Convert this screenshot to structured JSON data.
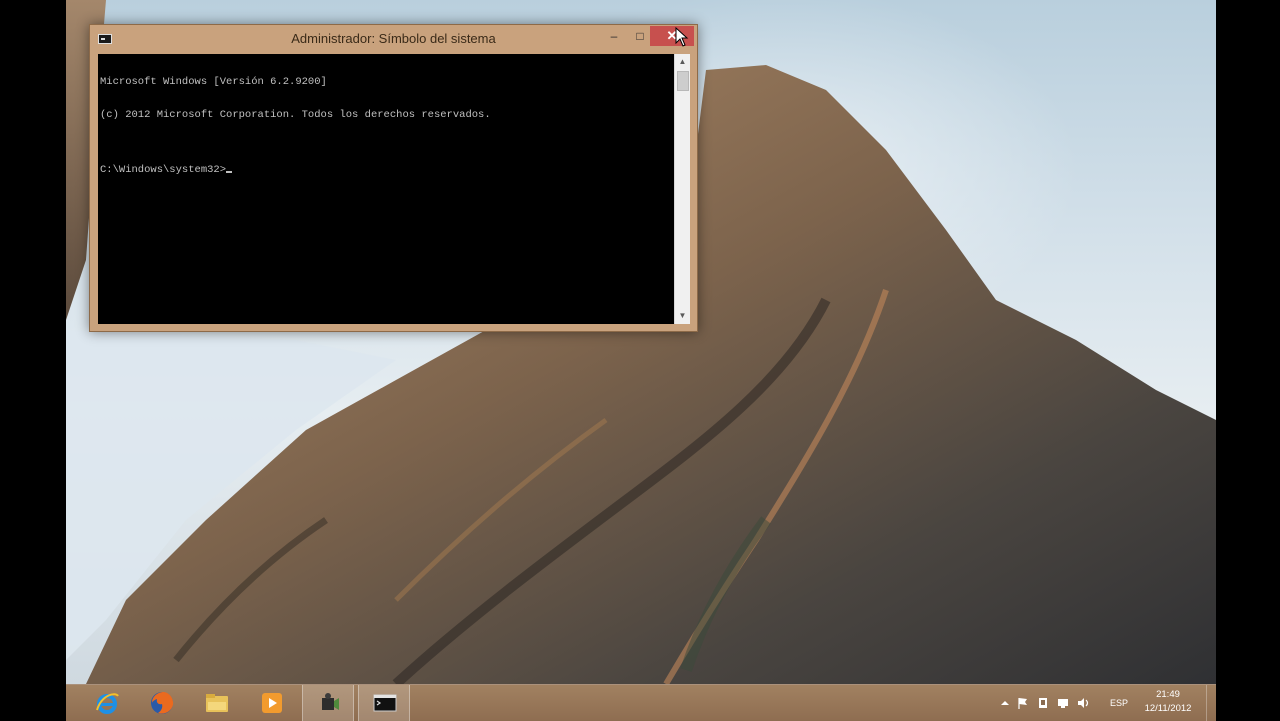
{
  "window": {
    "title": "Administrador: Símbolo del sistema",
    "minimize_glyph": "–",
    "maximize_glyph": "□",
    "close_glyph": "✕"
  },
  "console": {
    "lines": [
      "Microsoft Windows [Versión 6.2.9200]",
      "(c) 2012 Microsoft Corporation. Todos los derechos reservados.",
      "",
      "C:\\Windows\\system32>"
    ]
  },
  "taskbar": {
    "pinned": [
      {
        "name": "internet-explorer",
        "icon": "ie-icon"
      },
      {
        "name": "firefox",
        "icon": "firefox-icon"
      },
      {
        "name": "file-explorer",
        "icon": "folder-icon"
      },
      {
        "name": "media-player",
        "icon": "media-player-icon"
      },
      {
        "name": "camtasia",
        "icon": "camera-icon"
      },
      {
        "name": "command-prompt",
        "icon": "cmd-icon"
      }
    ],
    "tray": {
      "language": "ESP",
      "time": "21:49",
      "date": "12/11/2012"
    }
  },
  "colors": {
    "window_frame": "#c9a27d",
    "close_button": "#c7504e",
    "console_bg": "#000000",
    "console_fg": "#c0c0c0"
  }
}
